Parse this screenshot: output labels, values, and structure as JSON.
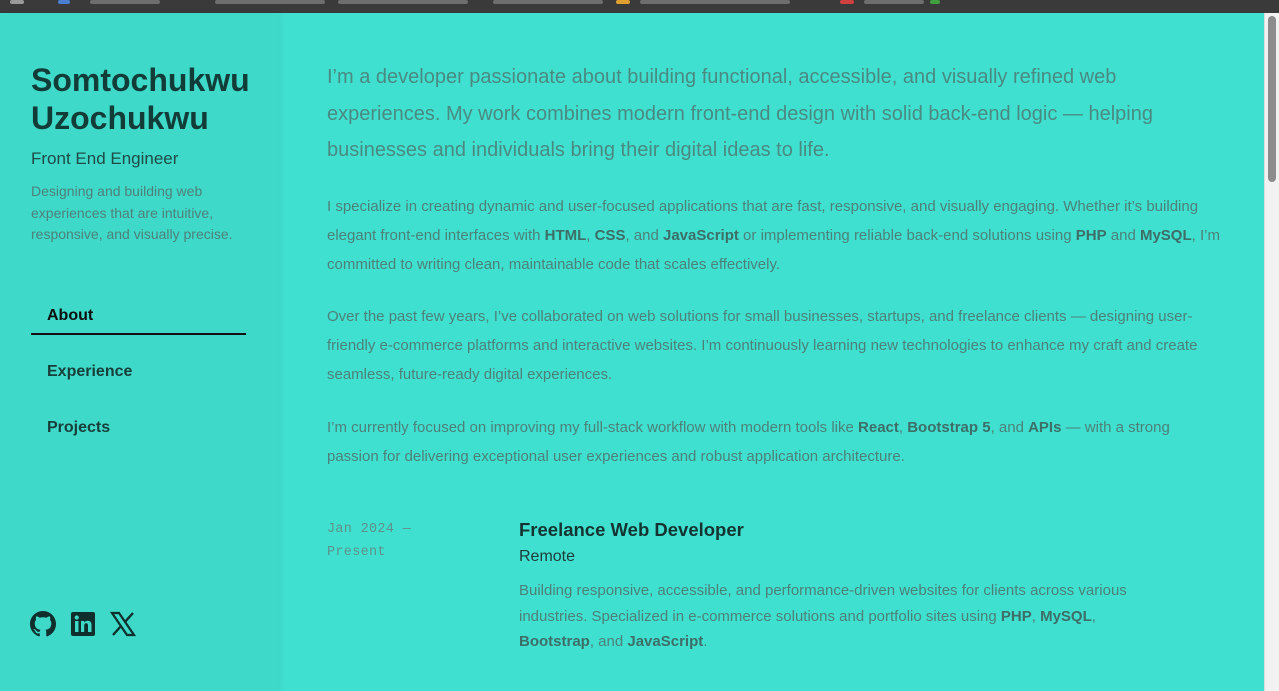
{
  "profile": {
    "name": "Somtochukwu Uzochukwu",
    "role": "Front End Engineer",
    "tagline": "Designing and building web experiences that are intuitive, responsive, and visually precise."
  },
  "nav": [
    {
      "label": "About",
      "active": true
    },
    {
      "label": "Experience",
      "active": false
    },
    {
      "label": "Projects",
      "active": false
    }
  ],
  "social": [
    "github-icon",
    "linkedin-icon",
    "x-icon"
  ],
  "colors": {
    "background": "#40e0d0",
    "sidebar": "#3ed9c9",
    "heading": "#123c38"
  },
  "about": {
    "intro": "I’m a developer passionate about building functional, accessible, and visually refined web experiences. My work combines modern front-end design with solid back-end logic — helping businesses and individuals bring their digital ideas to life.",
    "p1": {
      "t1": "I specialize in creating dynamic and user-focused applications that are fast, responsive, and visually engaging. Whether it’s building elegant front-end interfaces with ",
      "b1": "HTML",
      "t2": ", ",
      "b2": "CSS",
      "t3": ", and ",
      "b3": "JavaScript",
      "t4": " or implementing reliable back-end solutions using ",
      "b4": "PHP",
      "t5": " and ",
      "b5": "MySQL",
      "t6": ", I’m committed to writing clean, maintainable code that scales effectively."
    },
    "p2": "Over the past few years, I’ve collaborated on web solutions for small businesses, startups, and freelance clients — designing user-friendly e-commerce platforms and interactive websites. I’m continuously learning new technologies to enhance my craft and create seamless, future-ready digital experiences.",
    "p3": {
      "t1": "I’m currently focused on improving my full-stack workflow with modern tools like ",
      "b1": "React",
      "t2": ", ",
      "b2": "Bootstrap 5",
      "t3": ", and ",
      "b3": "APIs",
      "t4": " — with a strong passion for delivering exceptional user experiences and robust application architecture."
    }
  },
  "experience": {
    "date": "Jan 2024 — Present",
    "title": "Freelance Web Developer",
    "location": "Remote",
    "desc": {
      "t1": "Building responsive, accessible, and performance-driven websites for clients across various industries. Specialized in e-commerce solutions and portfolio sites using ",
      "b1": "PHP",
      "t2": ", ",
      "b2": "MySQL",
      "t3": ", ",
      "b3": "Bootstrap",
      "t4": ", and ",
      "b4": "JavaScript",
      "t5": "."
    }
  }
}
